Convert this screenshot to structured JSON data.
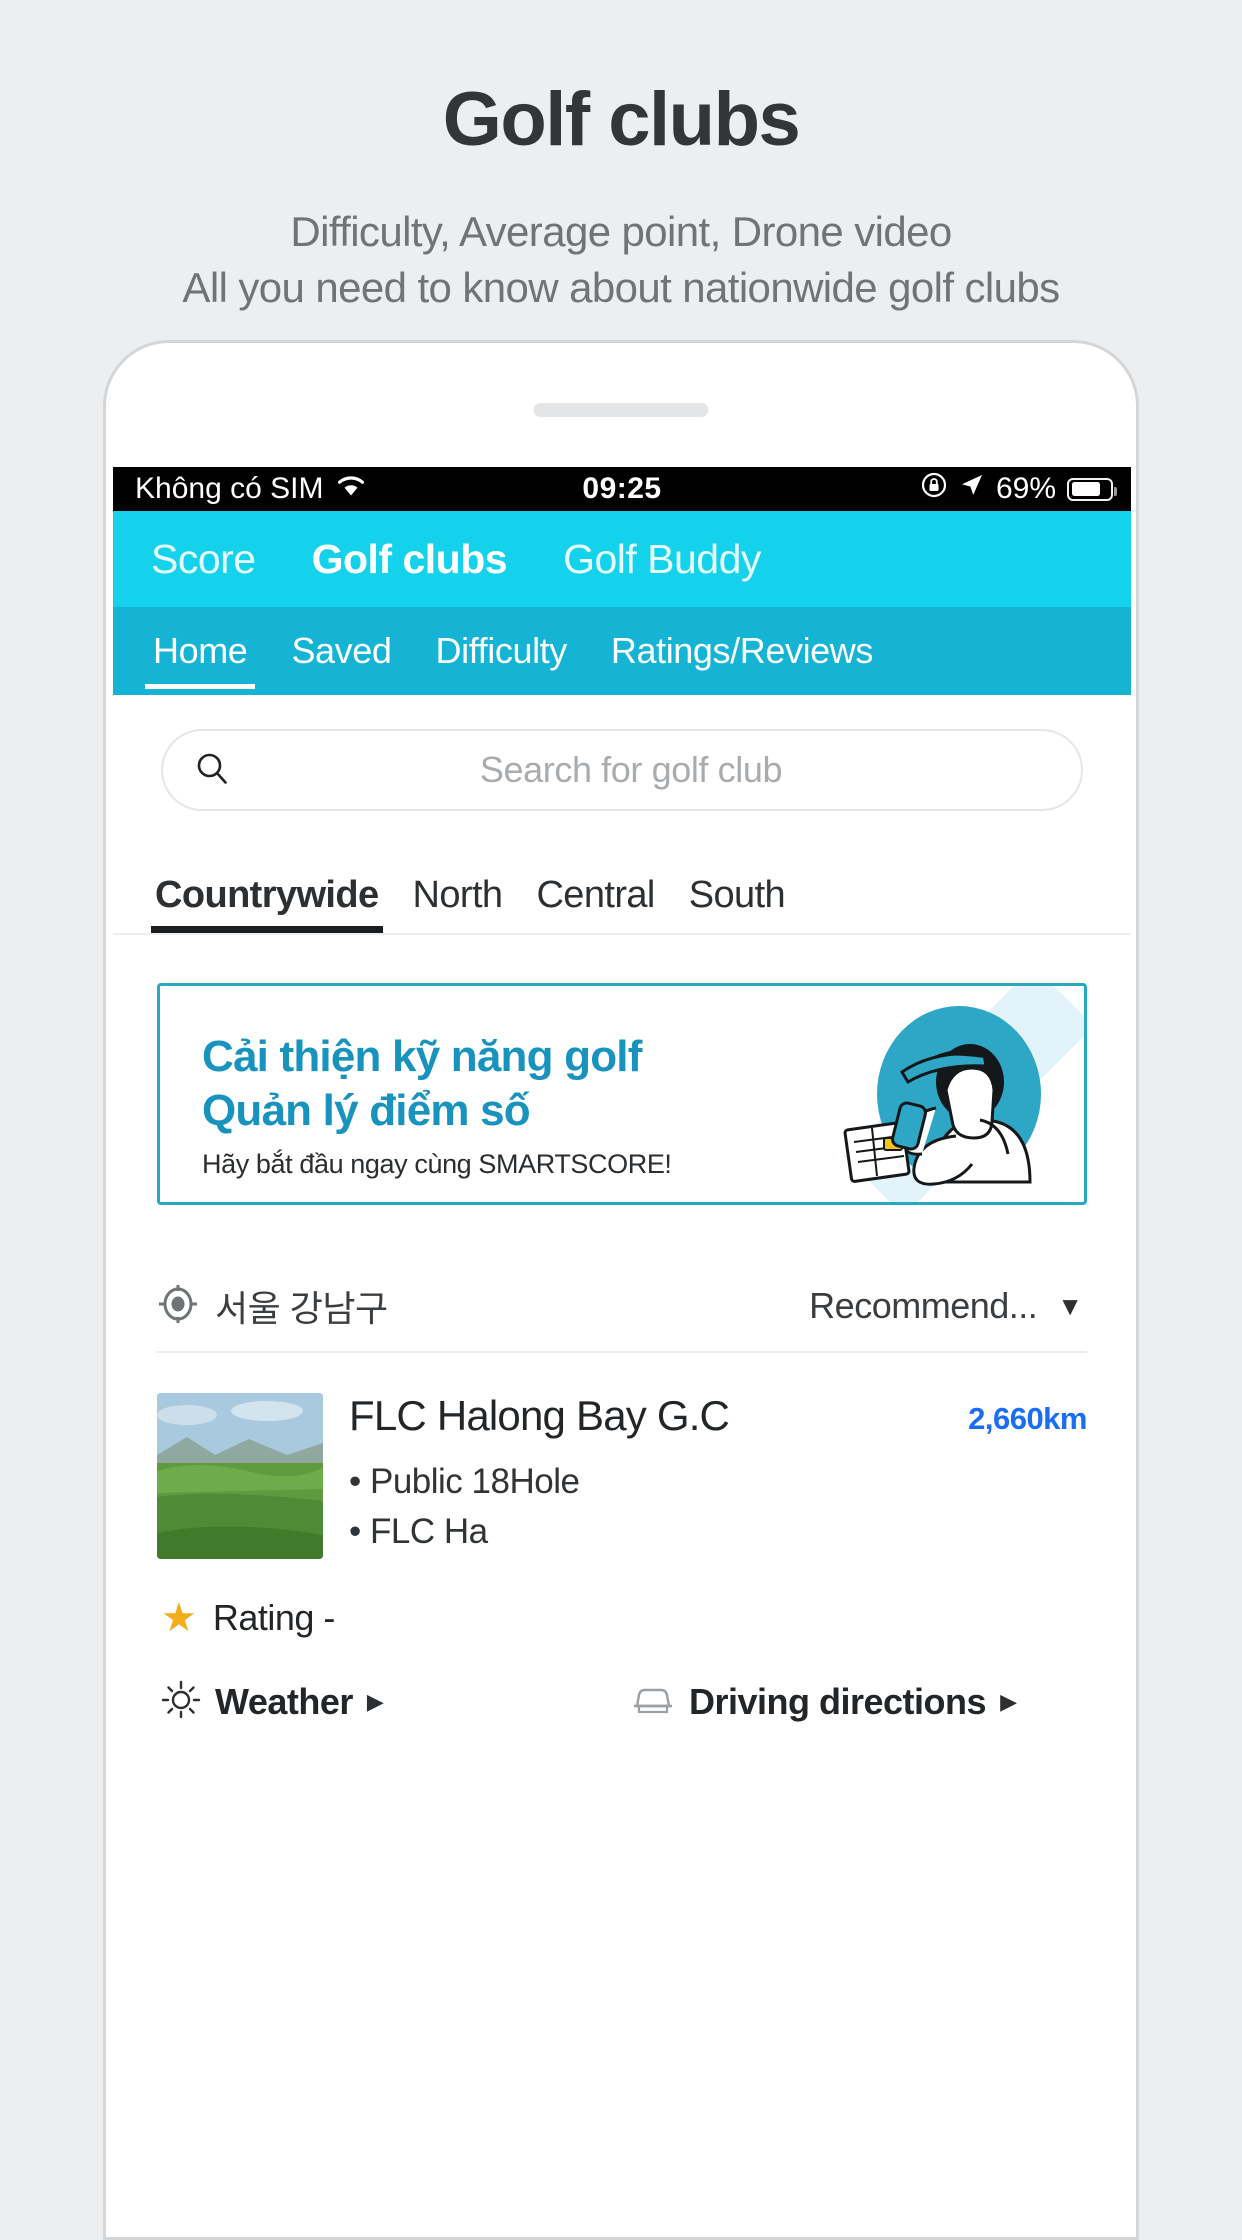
{
  "promo": {
    "title": "Golf clubs",
    "subtitle_line1": "Difficulty, Average point, Drone video",
    "subtitle_line2": "All you need to know about nationwide golf clubs"
  },
  "status_bar": {
    "carrier": "Không có SIM",
    "wifi_icon": "wifi-icon",
    "time": "09:25",
    "orientation_lock_icon": "orientation-lock-icon",
    "location_icon": "location-arrow-icon",
    "battery_percent": "69%",
    "battery_icon": "battery-icon"
  },
  "top_nav": {
    "background": "#14d2ec",
    "items": [
      {
        "label": "Score",
        "active": false
      },
      {
        "label": "Golf clubs",
        "active": true
      },
      {
        "label": "Golf Buddy",
        "active": false
      }
    ]
  },
  "sub_nav": {
    "background": "#15b3d4",
    "items": [
      {
        "label": "Home",
        "active": true
      },
      {
        "label": "Saved",
        "active": false
      },
      {
        "label": "Difficulty",
        "active": false
      },
      {
        "label": "Ratings/Reviews",
        "active": false
      }
    ]
  },
  "search": {
    "icon": "search-icon",
    "placeholder": "Search for golf club",
    "value": ""
  },
  "region_tabs": [
    {
      "label": "Countrywide",
      "active": true
    },
    {
      "label": "North",
      "active": false
    },
    {
      "label": "Central",
      "active": false
    },
    {
      "label": "South",
      "active": false
    }
  ],
  "banner": {
    "line1": "Cải thiện kỹ năng golf",
    "line2": "Quản lý điểm số",
    "line3": "Hãy bắt đầu ngay cùng SMARTSCORE!",
    "accent_color": "#1793bd",
    "border_color": "#29a8c4",
    "illustration": "golfer-scoring-illustration"
  },
  "location_row": {
    "icon": "location-target-icon",
    "location": "서울 강남구",
    "sort_label": "Recommend...",
    "sort_caret_icon": "chevron-down-icon"
  },
  "club": {
    "thumbnail": "golf-course-photo",
    "name": "FLC Halong Bay G.C",
    "distance": "2,660km",
    "distance_color": "#1a6ef5",
    "meta": [
      "• Public 18Hole",
      "• FLC Ha"
    ],
    "rating_star_icon": "star-icon",
    "rating_label": "Rating -",
    "actions": [
      {
        "icon": "sun-weather-icon",
        "label": "Weather",
        "arrow": "▶"
      },
      {
        "icon": "car-icon",
        "label": "Driving directions",
        "arrow": "▶"
      }
    ]
  }
}
